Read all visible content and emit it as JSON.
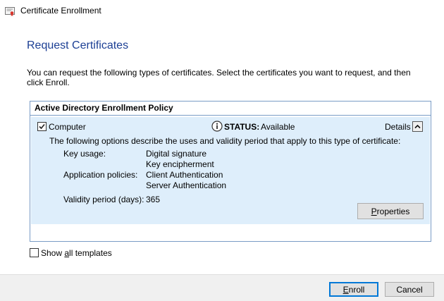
{
  "window": {
    "title": "Certificate Enrollment"
  },
  "page": {
    "heading": "Request Certificates",
    "intro": "You can request the following types of certificates. Select the certificates you want to request, and then click Enroll."
  },
  "policy": {
    "name": "Active Directory Enrollment Policy",
    "certificate": {
      "checked": true,
      "name": "Computer",
      "status_label": "STATUS:",
      "status_value": "Available",
      "details_label": "Details",
      "description": "The following options describe the uses and validity period that apply to this type of certificate:",
      "key_usage_label": "Key usage:",
      "key_usage": [
        "Digital signature",
        "Key encipherment"
      ],
      "app_policies_label": "Application policies:",
      "app_policies": [
        "Client Authentication",
        "Server Authentication"
      ],
      "validity_label": "Validity period (days):",
      "validity_value": "365",
      "properties_button": {
        "first": "P",
        "rest": "roperties"
      }
    }
  },
  "show_all": {
    "checked": false,
    "pre": "Show ",
    "accel": "a",
    "post": "ll templates"
  },
  "footer": {
    "enroll": {
      "accel": "E",
      "rest": "nroll"
    },
    "cancel": "Cancel"
  },
  "colors": {
    "heading": "#1c3f94",
    "panel_bg": "#deeefb",
    "border": "#7a9cc6",
    "default_button": "#0078d7"
  }
}
